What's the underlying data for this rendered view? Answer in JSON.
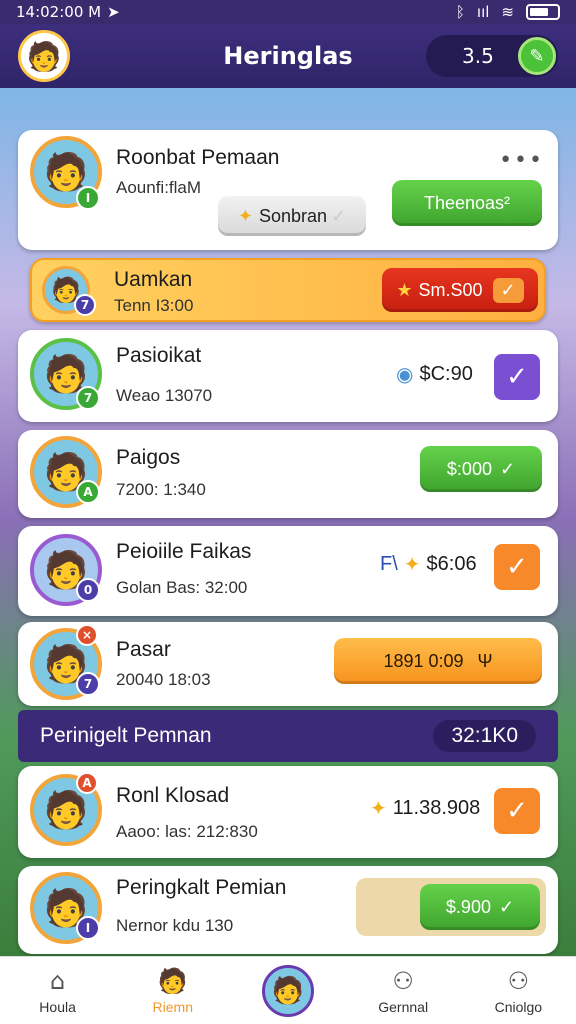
{
  "status": {
    "time": "14:02:00 M",
    "signal": "ııl"
  },
  "header": {
    "title": "Heringlas",
    "score": "3.5"
  },
  "cards": [
    {
      "name": "Roonbat Pemaan",
      "sub": "Aounfi:flaM",
      "badge": "I",
      "pill_label": "Sonbran",
      "button": "Theenoas²"
    },
    {
      "name": "Uamkan",
      "sub": "Tenn I3:00",
      "badge": "7",
      "button": "Sm.S00"
    },
    {
      "name": "Pasioikat",
      "sub": "Weao 13070",
      "badge": "7",
      "reward": "$C:90"
    },
    {
      "name": "Paigos",
      "sub": "7200: 1:340",
      "badge": "A",
      "button": "$:000"
    },
    {
      "name": "Peioiile Faikas",
      "sub": "Golan Bas: 32:00",
      "badge": "0",
      "reward_prefix": "F\\",
      "reward": "$6:06"
    },
    {
      "name": "Pasar",
      "sub": "20040 18:03",
      "badge": "7",
      "button": "1891 0:09"
    }
  ],
  "section": {
    "title": "Perinigelt Pemnan",
    "value": "32:1K0"
  },
  "cards2": [
    {
      "name": "Ronl Klosad",
      "sub": "Aaoo: las: 212:830",
      "badge": "A",
      "reward": "11.38.908"
    },
    {
      "name": "Peringkalt Pemian",
      "sub": "Nernor kdu 130",
      "badge": "I",
      "button": "$.900"
    }
  ],
  "nav": [
    {
      "label": "Houla"
    },
    {
      "label": "Riemn"
    },
    {
      "label": ""
    },
    {
      "label": "Gernnal"
    },
    {
      "label": "Cniolgo"
    }
  ]
}
